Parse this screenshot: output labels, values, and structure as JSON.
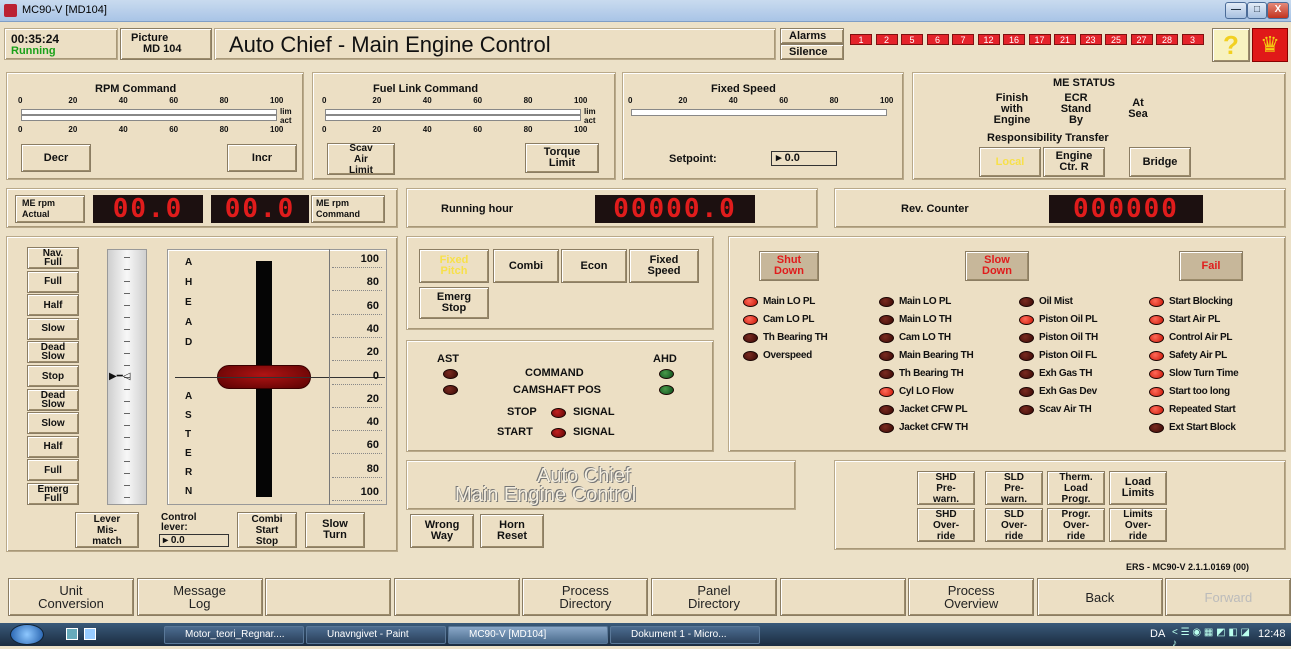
{
  "window": {
    "title": "MC90-V [MD104]",
    "controls": [
      "—",
      "□",
      "X"
    ]
  },
  "header": {
    "time": "00:35:24",
    "status": "Running",
    "picture_label": "Picture",
    "picture_value": "MD 104",
    "title": "Auto Chief - Main Engine Control",
    "alarms_label": "Alarms",
    "silence_label": "Silence",
    "alarm_lamps": [
      "1",
      "2",
      "5",
      "6",
      "7",
      "12",
      "16",
      "17",
      "21",
      "23",
      "25",
      "27",
      "28",
      "3"
    ],
    "help_icon": "question-icon",
    "logo": "lion-crest"
  },
  "rpm_command": {
    "title": "RPM Command",
    "ticks": [
      "0",
      "20",
      "40",
      "60",
      "80",
      "100"
    ],
    "lim": "lim",
    "act": "act",
    "decr": "Decr",
    "incr": "Incr"
  },
  "fuel_link": {
    "title": "Fuel Link Command",
    "ticks": [
      "0",
      "20",
      "40",
      "60",
      "80",
      "100"
    ],
    "lim": "lim",
    "act": "act",
    "scav": "Scav\nAir\nLimit",
    "torque": "Torque\nLimit"
  },
  "fixed_speed": {
    "title": "Fixed Speed",
    "ticks": [
      "0",
      "20",
      "40",
      "60",
      "80",
      "100"
    ],
    "setpoint_label": "Setpoint:",
    "setpoint_value": "0.0"
  },
  "me_status": {
    "title": "ME STATUS",
    "finish": "Finish\nwith\nEngine",
    "ecr": "ECR\nStand\nBy",
    "sea": "At\nSea",
    "resp_title": "Responsibility Transfer",
    "local": "Local",
    "engine": "Engine\nCtr. R",
    "bridge": "Bridge"
  },
  "rpm_displays": {
    "actual_label": "ME rpm\nActual",
    "actual_value": "00.0",
    "command_value": "00.0",
    "command_label": "ME rpm\nCommand"
  },
  "running_hour": {
    "label": "Running hour",
    "value": "00000.0"
  },
  "rev_counter": {
    "label": "Rev. Counter",
    "value": "000000"
  },
  "telegraph": {
    "left_buttons": [
      "Nav.\nFull",
      "Full",
      "Half",
      "Slow",
      "Dead\nSlow",
      "Stop",
      "Dead\nSlow",
      "Slow",
      "Half",
      "Full",
      "Emerg\nFull"
    ],
    "ahead_letters": [
      "A",
      "H",
      "E",
      "A",
      "D"
    ],
    "astern_letters": [
      "A",
      "S",
      "T",
      "E",
      "R",
      "N"
    ],
    "scale": [
      "100",
      "80",
      "60",
      "40",
      "20",
      "0",
      "20",
      "40",
      "60",
      "80",
      "100"
    ],
    "lever_value": 0,
    "lever_mismatch": "Lever\nMis-\nmatch",
    "control_lever_label": "Control\nlever:",
    "control_lever_value": "0.0",
    "combi_start_stop": "Combi\nStart\nStop",
    "slow_turn": "Slow\nTurn"
  },
  "modes": {
    "fixed_pitch": "Fixed\nPitch",
    "combi": "Combi",
    "econ": "Econ",
    "fixed_speed": "Fixed\nSpeed",
    "emerg_stop": "Emerg\nStop"
  },
  "command_panel": {
    "ast": "AST",
    "ahd": "AHD",
    "command": "COMMAND",
    "camshaft": "CAMSHAFT POS",
    "stop": "STOP",
    "start": "START",
    "signal": "SIGNAL"
  },
  "brand": {
    "line1": "Auto Chief",
    "line2": "Main Engine Control"
  },
  "bottom_left": {
    "wrong_way": "Wrong\nWay",
    "horn_reset": "Horn\nReset"
  },
  "alarm_panel": {
    "shut_down": "Shut\nDown",
    "slow_down": "Slow\nDown",
    "fail": "Fail",
    "col1": [
      {
        "t": "Main LO PL",
        "on": true
      },
      {
        "t": "Cam LO PL",
        "on": true
      },
      {
        "t": "Th Bearing TH",
        "on": false
      },
      {
        "t": "Overspeed",
        "on": false
      }
    ],
    "col2": [
      {
        "t": "Main LO PL",
        "on": false
      },
      {
        "t": "Main LO TH",
        "on": false
      },
      {
        "t": "Cam LO TH",
        "on": false
      },
      {
        "t": "Main Bearing TH",
        "on": false
      },
      {
        "t": "Th Bearing TH",
        "on": false
      },
      {
        "t": "Cyl LO Flow",
        "on": true
      },
      {
        "t": "Jacket CFW PL",
        "on": false
      },
      {
        "t": "Jacket CFW TH",
        "on": false
      }
    ],
    "col3": [
      {
        "t": "Oil Mist",
        "on": false
      },
      {
        "t": "Piston Oil PL",
        "on": true
      },
      {
        "t": "Piston Oil TH",
        "on": false
      },
      {
        "t": "Piston Oil FL",
        "on": false
      },
      {
        "t": "Exh Gas TH",
        "on": false
      },
      {
        "t": "Exh Gas Dev",
        "on": false
      },
      {
        "t": "Scav Air TH",
        "on": false
      }
    ],
    "col4": [
      {
        "t": "Start Blocking",
        "on": true
      },
      {
        "t": "Start Air PL",
        "on": true
      },
      {
        "t": "Control Air PL",
        "on": true
      },
      {
        "t": "Safety Air PL",
        "on": true
      },
      {
        "t": "Slow Turn Time",
        "on": true
      },
      {
        "t": "Start too long",
        "on": true
      },
      {
        "t": "Repeated Start",
        "on": true
      },
      {
        "t": "Ext Start Block",
        "on": false
      }
    ]
  },
  "limits": {
    "shd_pre": "SHD\nPre-\nwarn.",
    "sld_pre": "SLD\nPre-\nwarn.",
    "therm": "Therm.\nLoad\nProgr.",
    "load_limits": "Load\nLimits",
    "shd_over": "SHD\nOver-\nride",
    "sld_over": "SLD\nOver-\nride",
    "progr_over": "Progr.\nOver-\nride",
    "limits_over": "Limits\nOver-\nride"
  },
  "version": "ERS - MC90-V 2.1.1.0169 (00)",
  "bottom_nav": [
    "Unit\nConversion",
    "Message\nLog",
    "",
    "",
    "Process\nDirectory",
    "Panel\nDirectory",
    "",
    "Process\nOverview",
    "Back",
    "Forward"
  ],
  "taskbar": {
    "tasks": [
      "Motor_teori_Regnar....",
      "Unavngivet - Paint",
      "MC90-V [MD104]",
      "Dokument 1 - Micro..."
    ],
    "lang": "DA",
    "clock": "12:48"
  }
}
